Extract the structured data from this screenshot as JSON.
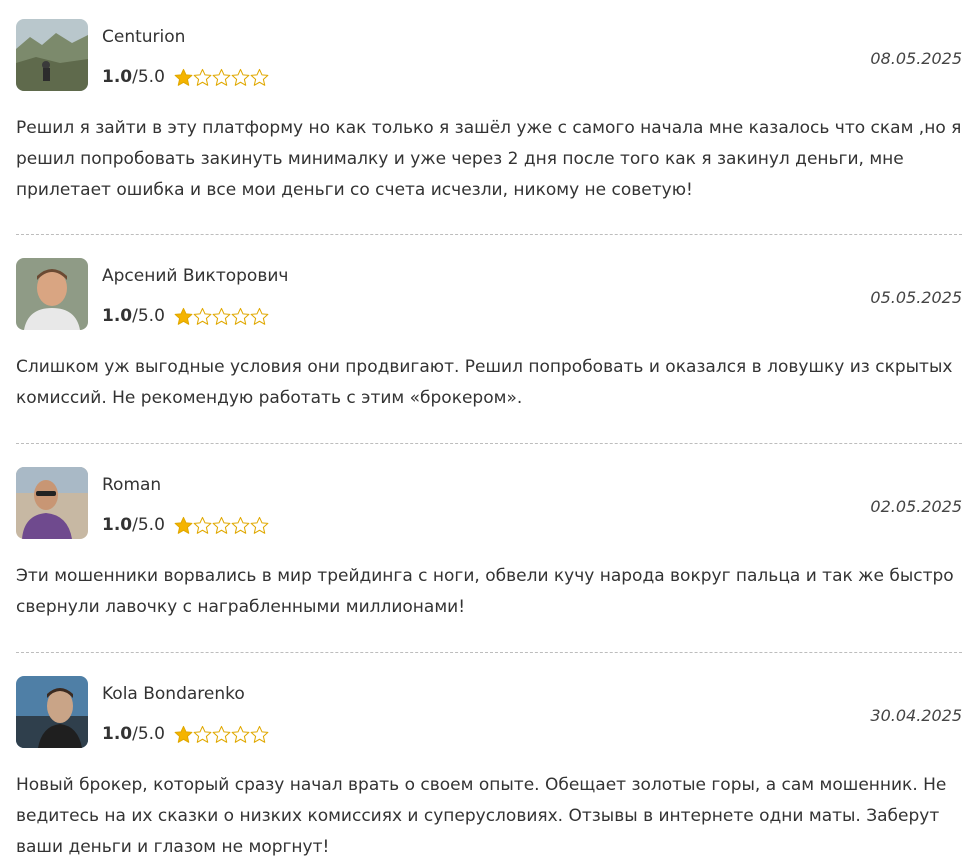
{
  "reviews": [
    {
      "author": "Centurion",
      "score": "1.0",
      "max": "/5.0",
      "rating_value": 1.0,
      "rating_max": 5,
      "date": "08.05.2025",
      "text": "Решил я зайти в эту платформу но как только я зашёл уже с самого начала мне казалось что скам ,но я решил попробовать закинуть минималку и уже через 2 дня после того как я закинул деньги, мне прилетает ошибка и все мои деньги со счета исчезли, никому не советую!"
    },
    {
      "author": "Арсений Викторович",
      "score": "1.0",
      "max": "/5.0",
      "rating_value": 1.0,
      "rating_max": 5,
      "date": "05.05.2025",
      "text": "Слишком уж выгодные условия они продвигают. Решил попробовать и оказался в ловушку из скрытых комиссий. Не рекомендую работать с этим «брокером»."
    },
    {
      "author": "Roman",
      "score": "1.0",
      "max": "/5.0",
      "rating_value": 1.0,
      "rating_max": 5,
      "date": "02.05.2025",
      "text": "Эти мошенники ворвались в мир трейдинга с ноги, обвели кучу народа вокруг пальца и так же быстро свернули лавочку с награбленными миллионами!"
    },
    {
      "author": "Kola Bondarenko",
      "score": "1.0",
      "max": "/5.0",
      "rating_value": 1.0,
      "rating_max": 5,
      "date": "30.04.2025",
      "text": "Новый брокер, который сразу начал врать о своем опыте. Обещает золотые горы, а сам мошенник. Не ведитесь на их сказки о низких комиссиях и суперусловиях. Отзывы в интернете одни маты. Заберут ваши деньги и глазом не моргнут!"
    }
  ],
  "colors": {
    "star": "#f5b400",
    "star_outline": "#e0a800",
    "divider": "#bdbdbd",
    "text": "#333333"
  }
}
